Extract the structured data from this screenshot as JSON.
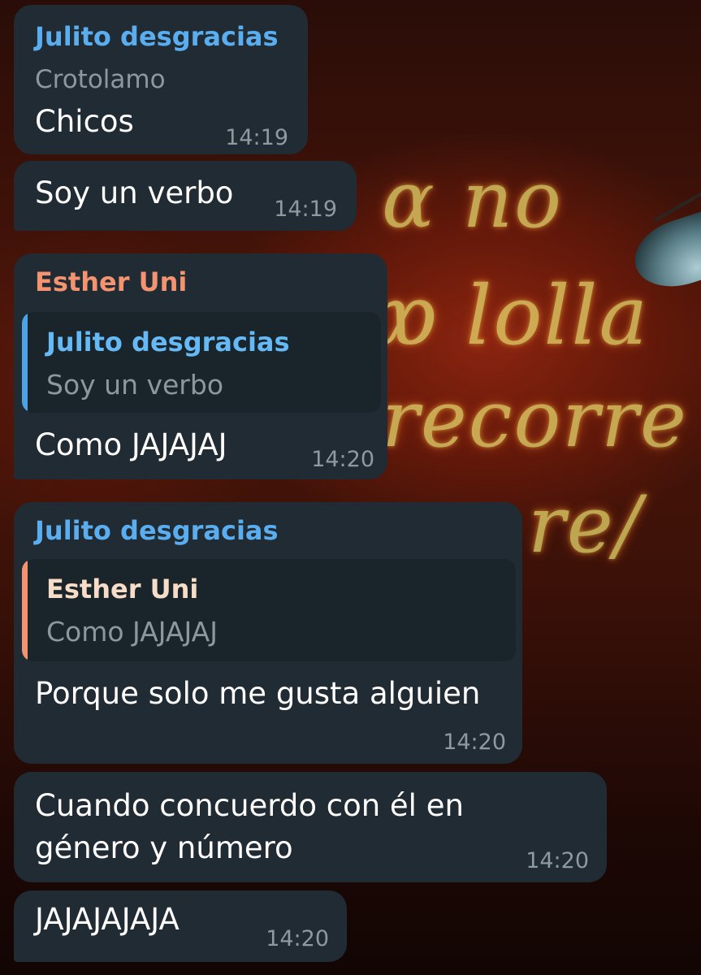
{
  "messages": [
    {
      "sender": "Julito desgracias",
      "subtitle": "Crotolamo",
      "text": "Chicos",
      "time": "14:19"
    },
    {
      "text": "Soy un verbo",
      "time": "14:19"
    },
    {
      "sender": "Esther Uni",
      "reply": {
        "name": "Julito desgracias",
        "text": "Soy un verbo"
      },
      "text": "Como JAJAJAJ",
      "time": "14:20"
    },
    {
      "sender": "Julito desgracias",
      "reply": {
        "name": "Esther Uni",
        "text": "Como JAJAJAJ"
      },
      "text": "Porque solo me gusta alguien",
      "time": "14:20"
    },
    {
      "text_line1": "Cuando concuerdo con él en",
      "text_line2": "género y número",
      "time": "14:20"
    },
    {
      "text": "JAJAJAJAJA",
      "time": "14:20"
    }
  ],
  "colors": {
    "bubble": "#202b33",
    "sender_blue": "#5aaef0",
    "sender_orange": "#f3936f",
    "timestamp": "#8f999f"
  }
}
